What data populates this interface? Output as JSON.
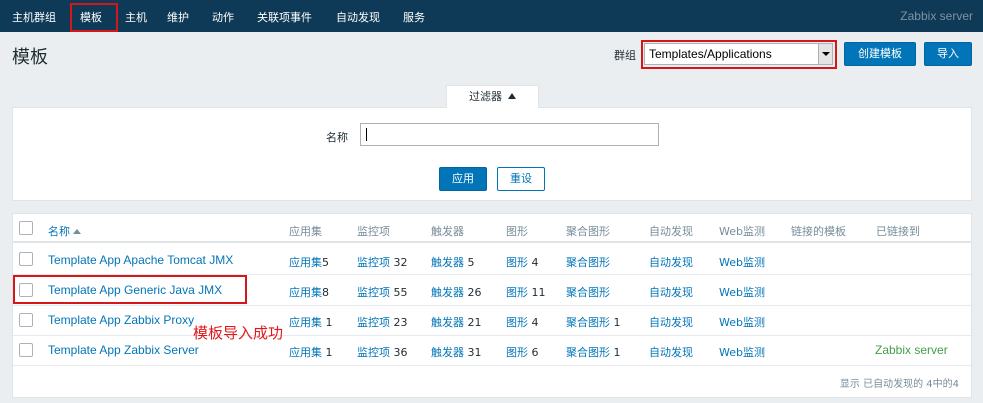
{
  "nav": {
    "items": [
      "主机群组",
      "模板",
      "主机",
      "维护",
      "动作",
      "关联项事件",
      "自动发现",
      "服务"
    ],
    "brand": "Zabbix server"
  },
  "header": {
    "title": "模板",
    "group_label": "群组",
    "group_value": "Templates/Applications",
    "create_button": "创建模板",
    "import_button": "导入"
  },
  "filter": {
    "tab_label": "过滤器",
    "name_label": "名称",
    "name_value": "",
    "apply_button": "应用",
    "reset_button": "重设"
  },
  "table": {
    "columns": [
      "名称",
      "应用集",
      "监控项",
      "触发器",
      "图形",
      "聚合图形",
      "自动发现",
      "Web监测",
      "链接的模板",
      "已链接到"
    ],
    "rows": [
      {
        "name": "Template App Apache Tomcat JMX",
        "app_label": "应用集",
        "app_count": "5",
        "items_label": "监控项",
        "items_count": "32",
        "triggers_label": "触发器",
        "triggers_count": "5",
        "graphs_label": "图形",
        "graphs_count": "4",
        "screens_label": "聚合图形",
        "screens_count": "",
        "discovery": "自动发现",
        "web": "Web监测",
        "linked_templates": "",
        "linked_to": ""
      },
      {
        "name": "Template App Generic Java JMX",
        "app_label": "应用集",
        "app_count": "8",
        "items_label": "监控项",
        "items_count": "55",
        "triggers_label": "触发器",
        "triggers_count": "26",
        "graphs_label": "图形",
        "graphs_count": "11",
        "screens_label": "聚合图形",
        "screens_count": "",
        "discovery": "自动发现",
        "web": "Web监测",
        "linked_templates": "",
        "linked_to": ""
      },
      {
        "name": "Template App Zabbix Proxy",
        "app_label": "应用集",
        "app_count": "1",
        "items_label": "监控项",
        "items_count": "23",
        "triggers_label": "触发器",
        "triggers_count": "21",
        "graphs_label": "图形",
        "graphs_count": "4",
        "screens_label": "聚合图形",
        "screens_count": "1",
        "discovery": "自动发现",
        "web": "Web监测",
        "linked_templates": "",
        "linked_to": ""
      },
      {
        "name": "Template App Zabbix Server",
        "app_label": "应用集",
        "app_count": "1",
        "items_label": "监控项",
        "items_count": "36",
        "triggers_label": "触发器",
        "triggers_count": "31",
        "graphs_label": "图形",
        "graphs_count": "6",
        "screens_label": "聚合图形",
        "screens_count": "1",
        "discovery": "自动发现",
        "web": "Web监测",
        "linked_templates": "",
        "linked_to": "Zabbix server"
      }
    ],
    "footer": "显示 已自动发现的 4中的4"
  },
  "annotation": "模板导入成功",
  "colors": {
    "nav_bg": "#0e3a57",
    "accent": "#0275b8",
    "highlight_red": "#d7161a",
    "linked_green": "#429e47"
  }
}
